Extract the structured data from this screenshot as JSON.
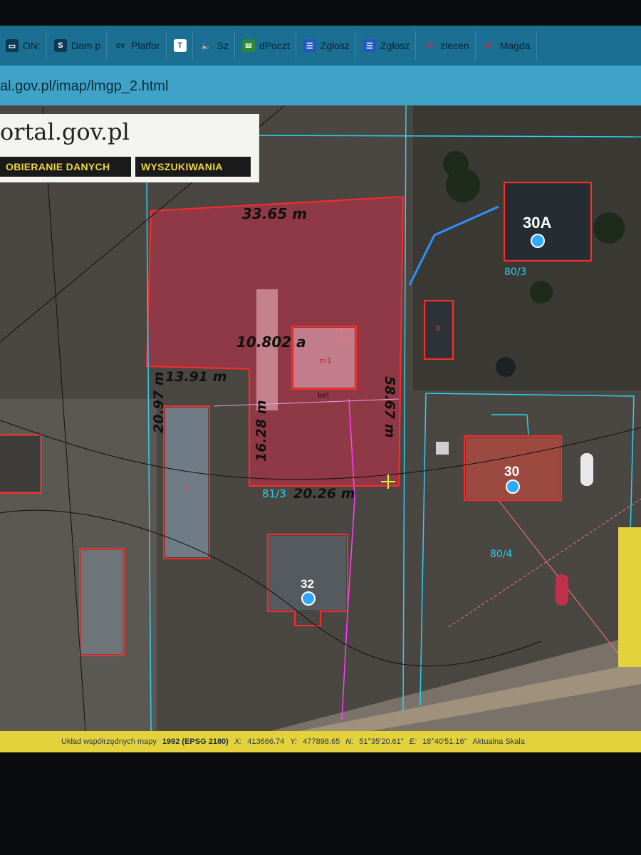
{
  "bookmarks": [
    {
      "label": "ON:",
      "icon": "tab-icon"
    },
    {
      "label": "Dam p",
      "icon": "s-logo-icon"
    },
    {
      "label": "Platfor",
      "icon": "cv-icon"
    },
    {
      "label": "",
      "icon": "t-circle-icon"
    },
    {
      "label": "Sz",
      "icon": "speaker-icon"
    },
    {
      "label": "dPoczt",
      "icon": "mailbox-icon"
    },
    {
      "label": "Zgłosz",
      "icon": "form-icon"
    },
    {
      "label": "Zgłosz",
      "icon": "form-icon"
    },
    {
      "label": "zlecen",
      "icon": "gmail-icon"
    },
    {
      "label": "Magda",
      "icon": "gmail-icon"
    }
  ],
  "address": {
    "url": "al.gov.pl/imap/lmgp_2.html"
  },
  "site": {
    "title": "ortal.gov.pl",
    "nav": [
      "OBIERANIE DANYCH",
      "WYSZUKIWANIA"
    ]
  },
  "map": {
    "dimensions": {
      "top": "33.65 m",
      "left": "20.97 m",
      "step": "13.91 m",
      "mid": "16.28 m",
      "bottom": "20.26 m",
      "right": "58.67 m"
    },
    "area": "10.802 a",
    "parcel_labels": [
      "81/3",
      "80/4",
      "80/3"
    ],
    "building_codes": [
      "m1",
      "bet",
      "ti",
      "ti"
    ],
    "house_numbers": [
      "30A",
      "30",
      "32"
    ]
  },
  "status": {
    "prefix": "Układ współrzędnych mapy",
    "crs": "1992 (EPSG 2180)",
    "x_label": "X:",
    "x_value": "413666.74",
    "y_label": "Y:",
    "y_value": "477898.65",
    "n_label": "N:",
    "n_value": "51°35'20.61\"",
    "e_label": "E:",
    "e_value": "18°40'51.16\"",
    "scale_label": "Aktualna Skala"
  },
  "colors": {
    "parcel_highlight": "#c0304a",
    "boundary_red": "#ff2a2a",
    "boundary_cyan": "#2fd0f0",
    "utility_magenta": "#ff40ff",
    "bookmark_bar": "#1a6f93",
    "status_bar": "#e4d23c"
  }
}
